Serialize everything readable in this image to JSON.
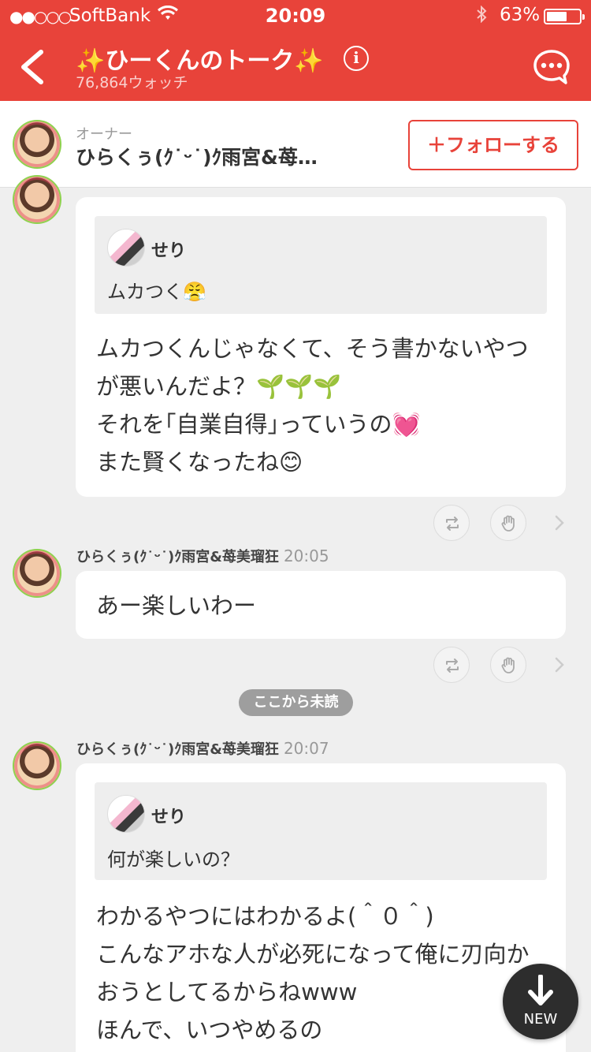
{
  "status_bar": {
    "signal": "●●○○○",
    "carrier": "SoftBank",
    "time": "20:09",
    "battery": "63%",
    "battery_level": 0.63
  },
  "header": {
    "title_prefix": "✨",
    "title": "ひーくんのトーク",
    "title_suffix": "✨",
    "watch_count": "76,864ウォッチ",
    "info_label": "i"
  },
  "owner": {
    "role": "オーナー",
    "name": "ひらくぅ(ｸ˙ᵕ˙)ｸ雨宮&苺…",
    "follow_label": "＋フォローする"
  },
  "messages": [
    {
      "quote": {
        "name": "せり",
        "text": "ムカつく😤"
      },
      "body": "ムカつくんじゃなくて、そう書かないやつ\nが悪いんだよ？🌱🌱🌱\nそれを｢自業自得｣っていうの💓\nまた賢くなったね😊"
    },
    {
      "author": "ひらくぅ(ｸ˙ᵕ˙)ｸ雨宮&苺美瑠狂",
      "time": "20:05",
      "body": "あー楽しいわー"
    },
    {
      "author": "ひらくぅ(ｸ˙ᵕ˙)ｸ雨宮&苺美瑠狂",
      "time": "20:07",
      "quote": {
        "name": "せり",
        "text": "何が楽しいの？"
      },
      "body": "わかるやつにはわかるよ(＾０＾)\nこんなアホな人が必死になって俺に刃向か\nおうとしてるからねwww\nほんで、いつやめるの"
    }
  ],
  "unread_divider": "ここから未読",
  "new_button": "NEW",
  "colors": {
    "accent": "#e8433a",
    "background": "#efefef"
  }
}
